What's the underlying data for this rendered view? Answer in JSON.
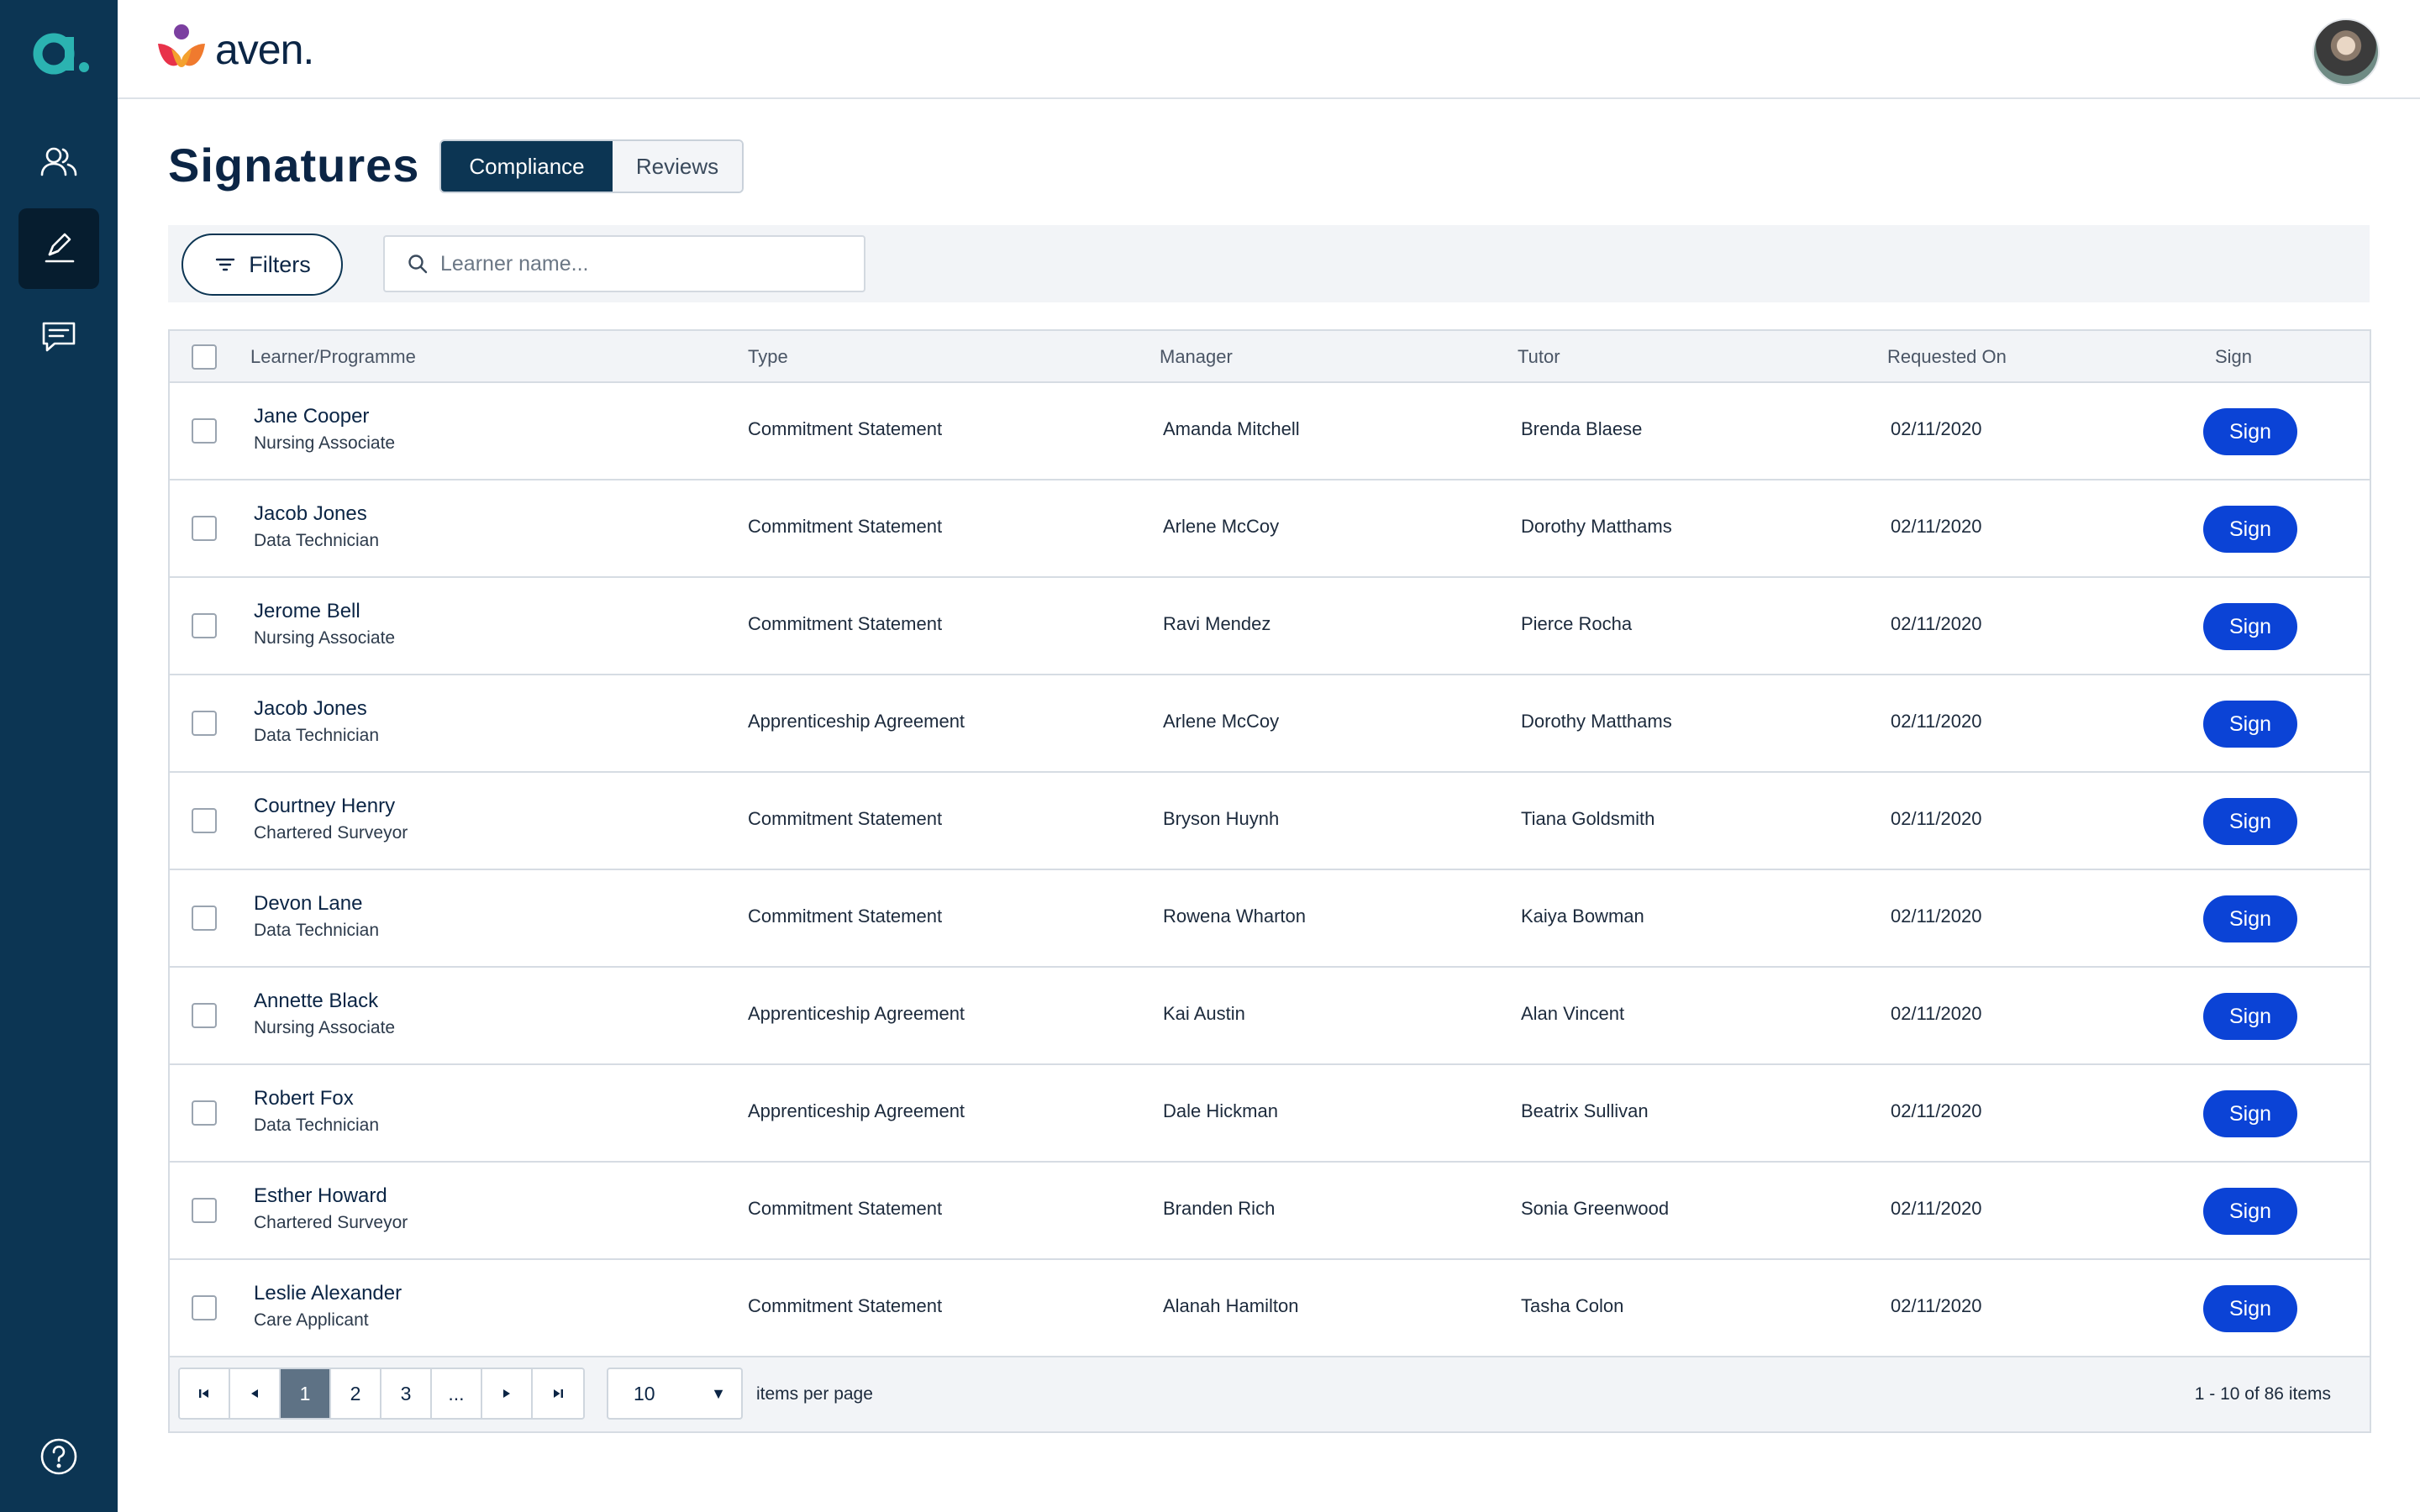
{
  "sidebar": {
    "logo_letter": "a.",
    "items": [
      {
        "name": "users",
        "icon": "users-icon",
        "active": false
      },
      {
        "name": "signatures",
        "icon": "pen-sign-icon",
        "active": true
      },
      {
        "name": "messages",
        "icon": "chat-icon",
        "active": false
      }
    ],
    "help_icon": "help-icon"
  },
  "header": {
    "brand": "aven.",
    "avatar_icon": "user-avatar"
  },
  "page": {
    "title": "Signatures",
    "tabs": [
      {
        "label": "Compliance",
        "active": true
      },
      {
        "label": "Reviews",
        "active": false
      }
    ]
  },
  "filters": {
    "button_label": "Filters",
    "search_placeholder": "Learner name..."
  },
  "table": {
    "columns": [
      "Learner/Programme",
      "Type",
      "Manager",
      "Tutor",
      "Requested On",
      "Sign"
    ],
    "sign_label": "Sign",
    "rows": [
      {
        "name": "Jane Cooper",
        "programme": "Nursing Associate",
        "type": "Commitment Statement",
        "manager": "Amanda Mitchell",
        "tutor": "Brenda Blaese",
        "requested": "02/11/2020"
      },
      {
        "name": "Jacob Jones",
        "programme": "Data Technician",
        "type": "Commitment Statement",
        "manager": "Arlene McCoy",
        "tutor": "Dorothy Matthams",
        "requested": "02/11/2020"
      },
      {
        "name": "Jerome Bell",
        "programme": "Nursing Associate",
        "type": "Commitment Statement",
        "manager": "Ravi Mendez",
        "tutor": "Pierce Rocha",
        "requested": "02/11/2020"
      },
      {
        "name": "Jacob Jones",
        "programme": "Data Technician",
        "type": "Apprenticeship Agreement",
        "manager": "Arlene McCoy",
        "tutor": "Dorothy Matthams",
        "requested": "02/11/2020"
      },
      {
        "name": "Courtney Henry",
        "programme": "Chartered Surveyor",
        "type": "Commitment Statement",
        "manager": "Bryson Huynh",
        "tutor": "Tiana Goldsmith",
        "requested": "02/11/2020"
      },
      {
        "name": "Devon Lane",
        "programme": "Data Technician",
        "type": "Commitment Statement",
        "manager": "Rowena Wharton",
        "tutor": "Kaiya Bowman",
        "requested": "02/11/2020"
      },
      {
        "name": "Annette Black",
        "programme": "Nursing Associate",
        "type": "Apprenticeship Agreement",
        "manager": "Kai Austin",
        "tutor": "Alan Vincent",
        "requested": "02/11/2020"
      },
      {
        "name": "Robert Fox",
        "programme": "Data Technician",
        "type": "Apprenticeship Agreement",
        "manager": "Dale Hickman",
        "tutor": "Beatrix Sullivan",
        "requested": "02/11/2020"
      },
      {
        "name": "Esther Howard",
        "programme": "Chartered Surveyor",
        "type": "Commitment Statement",
        "manager": "Branden Rich",
        "tutor": "Sonia Greenwood",
        "requested": "02/11/2020"
      },
      {
        "name": "Leslie Alexander",
        "programme": "Care Applicant",
        "type": "Commitment Statement",
        "manager": "Alanah Hamilton",
        "tutor": "Tasha Colon",
        "requested": "02/11/2020"
      }
    ]
  },
  "pagination": {
    "pages": [
      "1",
      "2",
      "3",
      "..."
    ],
    "current_page": "1",
    "per_page": "10",
    "per_page_label": "items per page",
    "range_text": "1 - 10 of 86 items"
  },
  "colors": {
    "sidebar": "#0c3553",
    "accent": "#0b43d6",
    "logo_teal": "#2bb3b1"
  }
}
